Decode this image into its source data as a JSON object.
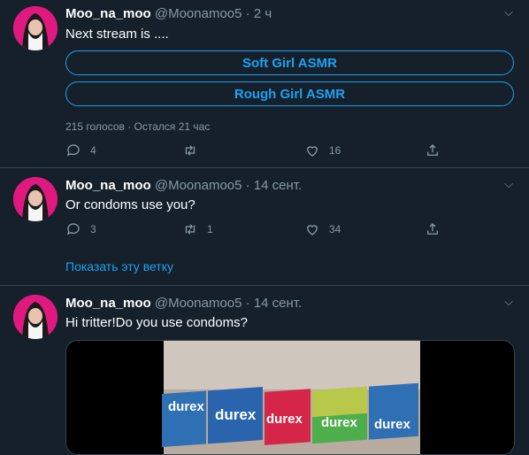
{
  "tweets": [
    {
      "name": "Moo_na_moo",
      "handle": "@Moonamoo5",
      "time": "· 2 ч",
      "text": "Next stream is ....",
      "poll": {
        "options": [
          "Soft Girl ASMR",
          "Rough Girl ASMR"
        ],
        "info": "215 голосов · Остался 21 час"
      },
      "actions": {
        "reply": "4",
        "retweet": "",
        "like": "16"
      }
    },
    {
      "name": "Moo_na_moo",
      "handle": "@Moonamoo5",
      "time": "· 14 сент.",
      "text": "Or condoms use you?",
      "actions": {
        "reply": "3",
        "retweet": "1",
        "like": "34"
      },
      "show_thread": "Показать эту ветку"
    },
    {
      "name": "Moo_na_moo",
      "handle": "@Moonamoo5",
      "time": "· 14 сент.",
      "text": "Hi tritter!Do you use condoms?",
      "media_labels": [
        "durex",
        "durex",
        "durex",
        "durex",
        "durex"
      ]
    }
  ],
  "colors": {
    "background": "#15202b",
    "accent": "#1da1f2",
    "muted": "#8899a6",
    "divider": "#38444d"
  }
}
